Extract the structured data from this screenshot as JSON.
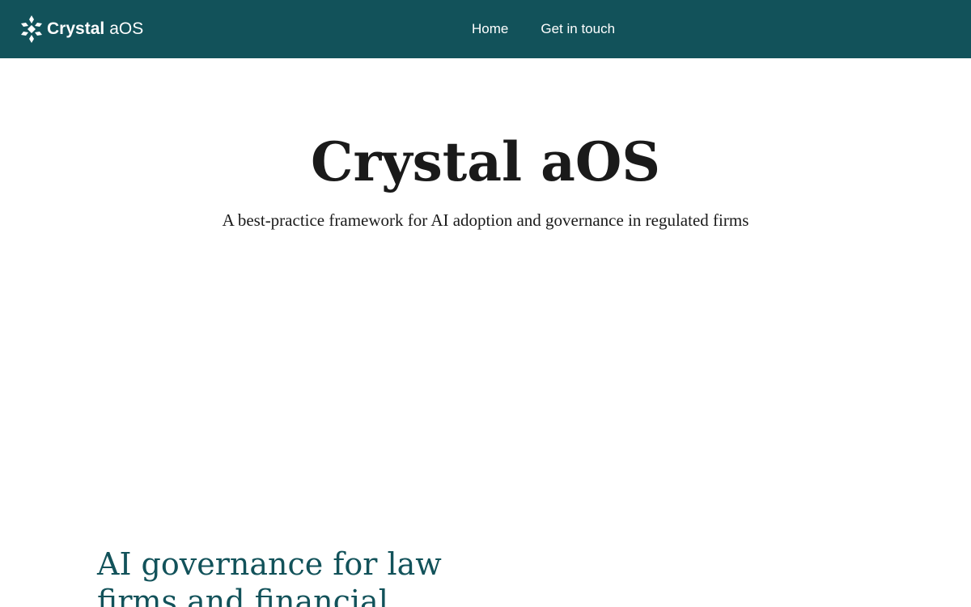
{
  "header": {
    "brand": {
      "icon": "crystal-logo-icon",
      "name_strong": "Crystal",
      "name_light": "aOS"
    },
    "nav": [
      {
        "label": "Home"
      },
      {
        "label": "Get in touch"
      }
    ]
  },
  "hero": {
    "title": "Crystal aOS",
    "subtitle": "A best-practice framework for AI adoption and governance in regulated firms"
  },
  "section": {
    "heading": "AI governance for law firms and financial"
  },
  "colors": {
    "header_bg": "#12525a",
    "heading_accent": "#12525a",
    "text": "#1a1a1a",
    "background": "#ffffff"
  }
}
